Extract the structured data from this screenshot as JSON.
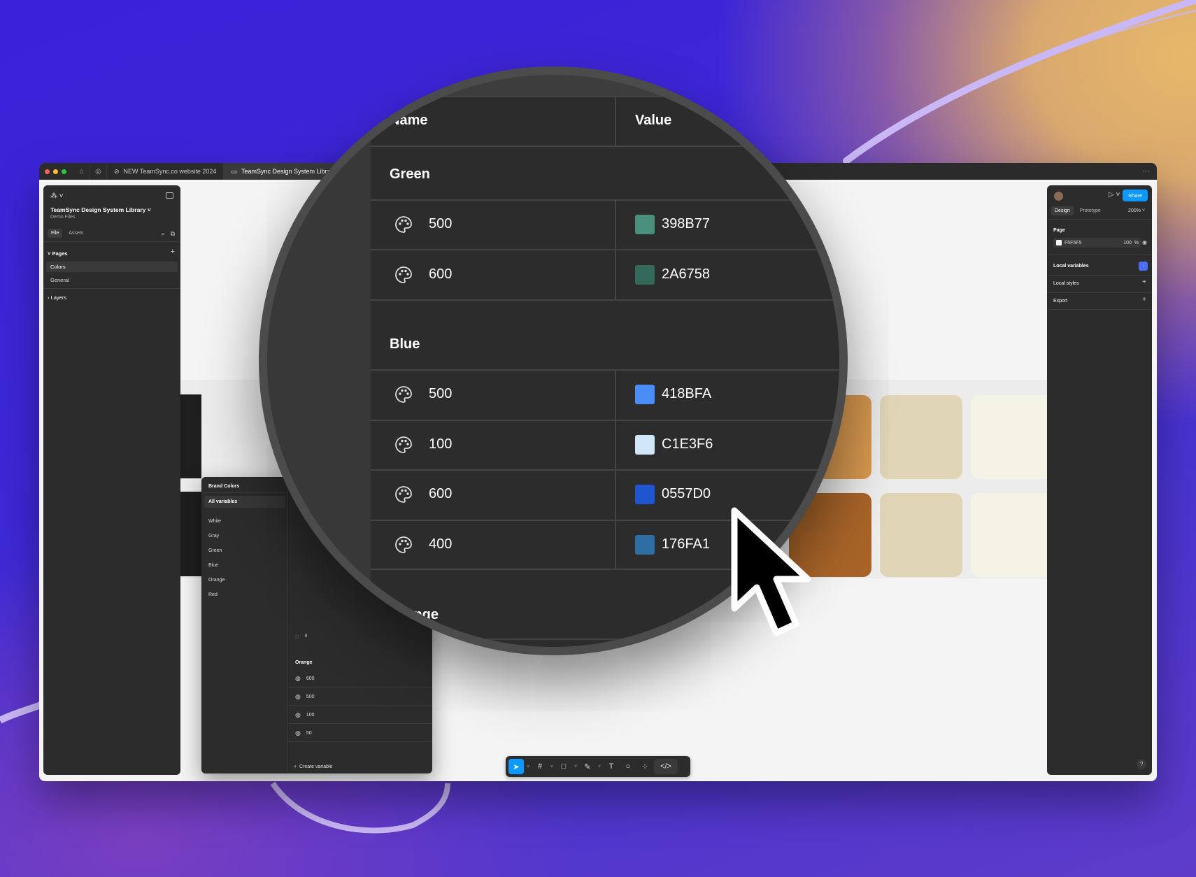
{
  "browser": {
    "tabs": [
      {
        "label": "NEW TeamSync.co website 2024"
      },
      {
        "label": "TeamSync Design System Librar"
      }
    ]
  },
  "left_panel": {
    "file_title": "TeamSync Design System Library",
    "file_subtitle": "Demo Files",
    "tabs": [
      "File",
      "Assets"
    ],
    "pages_label": "Pages",
    "pages": [
      "Colors",
      "General"
    ],
    "layers_label": "Layers"
  },
  "right_panel": {
    "share_label": "Share",
    "tabs": [
      "Design",
      "Prototype"
    ],
    "zoom": "200%",
    "page_label": "Page",
    "page_fill_hex": "F5F5F5",
    "page_fill_opacity": "100",
    "page_fill_pct": "%",
    "local_variables": "Local variables",
    "local_styles": "Local styles",
    "export": "Export",
    "help": "?"
  },
  "variables_modal": {
    "title": "Brand Colors",
    "all_variables": "All variables",
    "groups": [
      "White",
      "Gray",
      "Green",
      "Blue",
      "Orange",
      "Red"
    ],
    "orange_header": "Orange",
    "orange_rows": [
      "600",
      "500",
      "100",
      "50"
    ],
    "partial_row": "4",
    "create_variable": "Create variable"
  },
  "magnifier": {
    "col_name": "Name",
    "col_value": "Value",
    "green_label": "Green",
    "green_rows": [
      {
        "name": "500",
        "value": "398B77",
        "color": "#4a8f7c"
      },
      {
        "name": "600",
        "value": "2A6758",
        "color": "#35695c"
      }
    ],
    "blue_label": "Blue",
    "blue_rows": [
      {
        "name": "500",
        "value": "418BFA",
        "color": "#4b8df7"
      },
      {
        "name": "100",
        "value": "C1E3F6",
        "color": "#cfe6f6"
      },
      {
        "name": "600",
        "value": "0557D0",
        "color": "#1f56d0"
      },
      {
        "name": "400",
        "value": "176FA1",
        "color": "#2f6ea3"
      }
    ],
    "orange_label": "Orange"
  },
  "canvas_swatches": [
    {
      "color": "#d8994f"
    },
    {
      "color": "#e0d5b6"
    },
    {
      "color": "#f5f2e6"
    },
    {
      "color": "#a86428"
    },
    {
      "color": "#e0d5b6"
    },
    {
      "color": "#f5f2e6"
    }
  ],
  "colors": {
    "accent": "#0d99ff",
    "panel": "#2c2c2c"
  }
}
